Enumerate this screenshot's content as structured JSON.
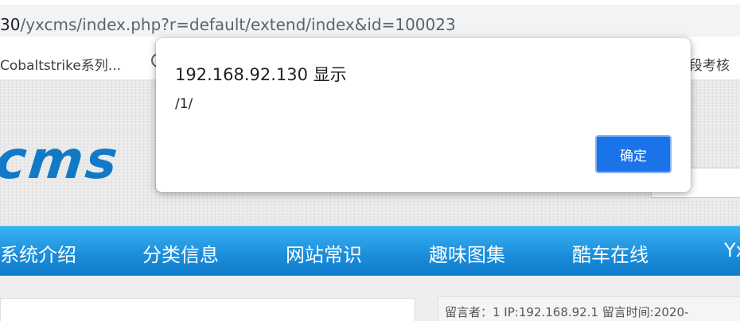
{
  "browser": {
    "address": {
      "host_fragment": "30",
      "path": "/yxcms/index.php?r=default/extend/index&id=100023"
    },
    "bookmarks": [
      {
        "label": "Cobaltstrike系列..."
      },
      {
        "label": "段考核"
      }
    ]
  },
  "site": {
    "logo_text": "cms",
    "nav_items": [
      {
        "label": "系统介绍"
      },
      {
        "label": "分类信息"
      },
      {
        "label": "网站常识"
      },
      {
        "label": "趣味图集"
      },
      {
        "label": "酷车在线"
      },
      {
        "label": "Yx"
      }
    ],
    "comment_meta": "留言者：1   IP:192.168.92.1   留言时间:2020-"
  },
  "dialog": {
    "title": "192.168.92.130 显示",
    "message": "/1/",
    "ok_label": "确定"
  },
  "colors": {
    "nav_blue": "#1c8fdc",
    "logo_blue": "#1279c7",
    "ok_button": "#1a73e8"
  }
}
